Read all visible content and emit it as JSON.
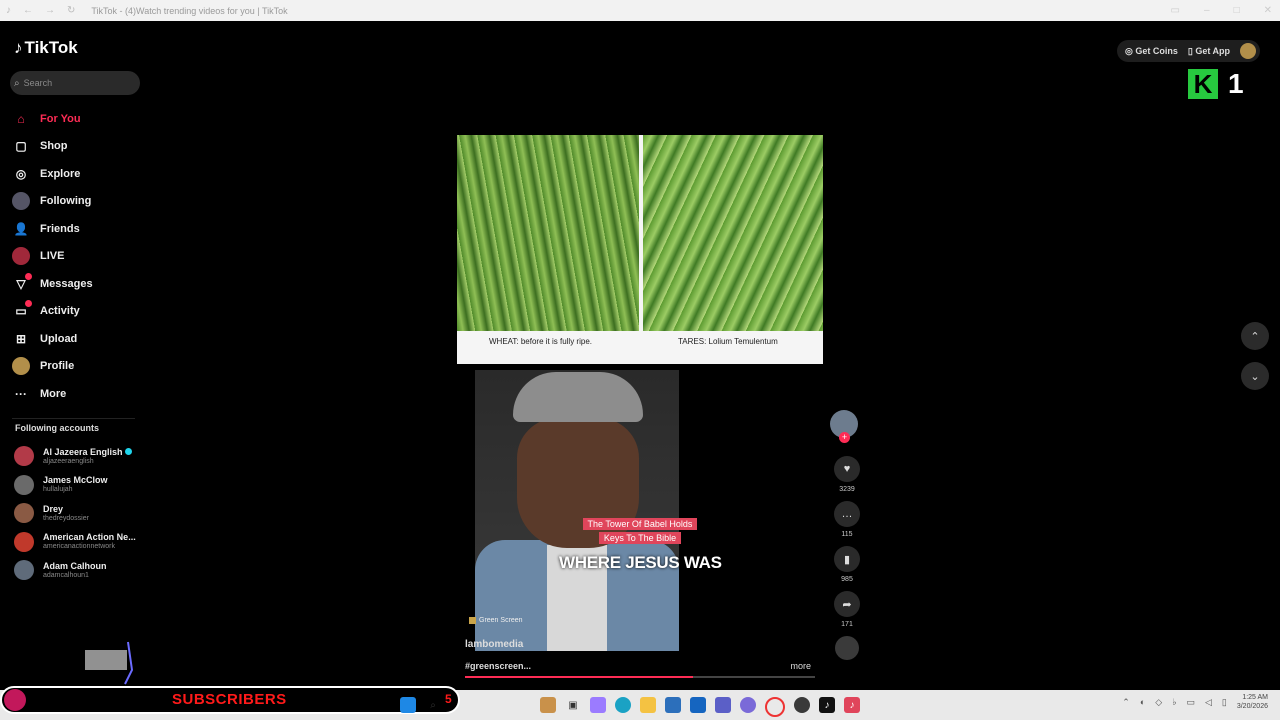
{
  "window": {
    "title": "TikTok - (4)Watch trending videos for you | TikTok",
    "back_icon": "back-arrow-icon",
    "forward_icon": "forward-arrow-icon",
    "reload_icon": "reload-icon"
  },
  "brand": {
    "logo_text": "TikTok",
    "accent": "#fe2c55"
  },
  "search": {
    "placeholder": "Search"
  },
  "nav": [
    {
      "label": "For You",
      "icon": "home-icon",
      "active": true
    },
    {
      "label": "Shop",
      "icon": "shop-bag-icon"
    },
    {
      "label": "Explore",
      "icon": "compass-icon"
    },
    {
      "label": "Following",
      "icon": "following-avatar-icon"
    },
    {
      "label": "Friends",
      "icon": "friends-icon"
    },
    {
      "label": "LIVE",
      "icon": "live-icon"
    },
    {
      "label": "Messages",
      "icon": "messages-icon"
    },
    {
      "label": "Activity",
      "icon": "activity-icon"
    },
    {
      "label": "Upload",
      "icon": "upload-icon"
    },
    {
      "label": "Profile",
      "icon": "profile-icon"
    },
    {
      "label": "More",
      "icon": "more-dots-icon"
    }
  ],
  "following": {
    "title": "Following accounts",
    "accounts": [
      {
        "name": "Al Jazeera English",
        "handle": "aljazeeraenglish",
        "verified": true,
        "color": "#b23a48"
      },
      {
        "name": "James McClow",
        "handle": "hullalujah",
        "color": "#6a6a6a"
      },
      {
        "name": "Drey",
        "handle": "thedreydossier",
        "color": "#8a5a44"
      },
      {
        "name": "American Action Ne...",
        "handle": "americanactionnetwork",
        "color": "#c0392b"
      },
      {
        "name": "Adam Calhoun",
        "handle": "adamcalhoun1",
        "color": "#5f6b7a"
      }
    ]
  },
  "top_right": {
    "coins_label": "Get Coins",
    "app_label": "Get App"
  },
  "overlay": {
    "k_logo": "K",
    "k_number": "1"
  },
  "video": {
    "left_caption": "WHEAT: before it is fully ripe.",
    "right_caption": "TARES: Lolium Temulentum",
    "title_tag_line1": "The Tower Of Babel Holds",
    "title_tag_line2": "Keys To The Bible",
    "big_caption": "WHERE JESUS WAS",
    "effect_label": "Green Screen",
    "author": "lambomedia",
    "description": "#greenscreen...",
    "more_label": "more",
    "progress": 0.65
  },
  "actions": {
    "likes": "3239",
    "comments": "115",
    "saves": "985",
    "shares": "171"
  },
  "subscribers_bar": {
    "label": "SUBSCRIBERS",
    "count": "5"
  },
  "taskbar": {
    "time": "1:25 AM",
    "date": "3/20/2026"
  }
}
